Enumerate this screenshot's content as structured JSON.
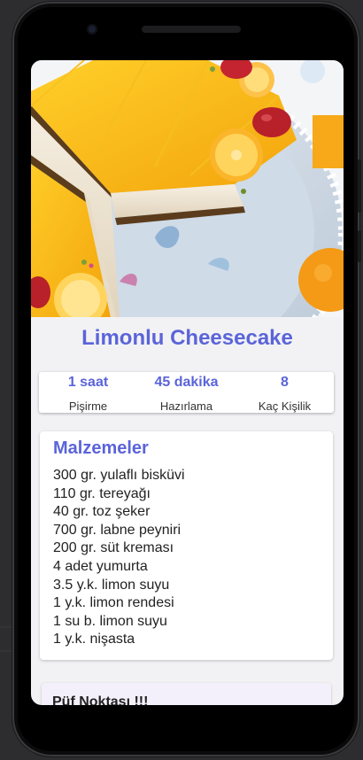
{
  "recipe": {
    "title": "Limonlu Cheesecake",
    "hero_image": "lemon-cheesecake-photo"
  },
  "stats": [
    {
      "value": "1 saat",
      "label": "Pişirme"
    },
    {
      "value": "45 dakika",
      "label": "Hazırlama"
    },
    {
      "value": "8",
      "label": "Kaç Kişilik"
    }
  ],
  "ingredients": {
    "title": "Malzemeler",
    "items": [
      "300 gr. yulaflı bisküvi",
      "110 gr. tereyağı",
      "40 gr. toz şeker",
      "700 gr. labne peyniri",
      "200 gr. süt kreması",
      "4 adet yumurta",
      "3.5 y.k. limon suyu",
      "1 y.k. limon rendesi",
      "1 su b. limon suyu",
      "1 y.k. nişasta"
    ]
  },
  "tip": {
    "title": "Püf Noktası !!!"
  },
  "colors": {
    "accent": "#5b64d9",
    "phone_body": "#0b0b0c",
    "screen_bg": "#f2f2f4",
    "tip_bg": "#f3f0fb"
  }
}
